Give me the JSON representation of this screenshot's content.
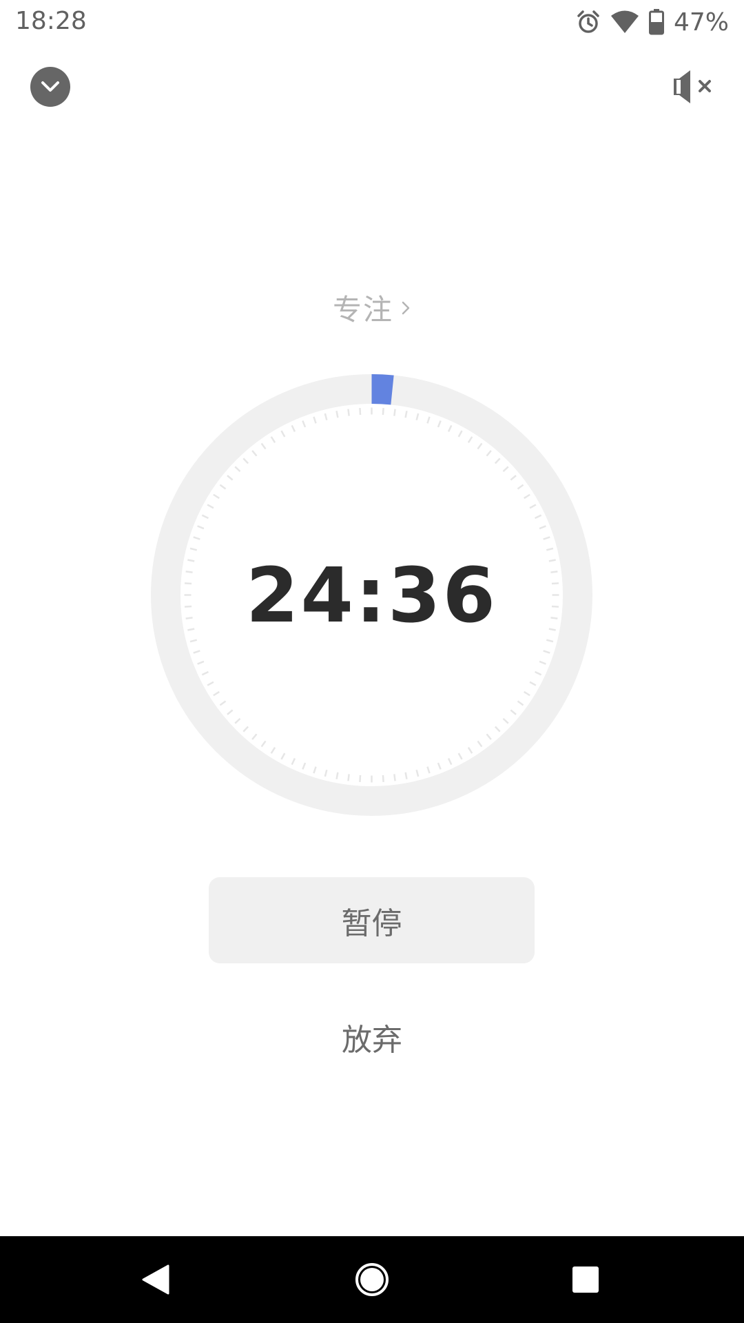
{
  "status_bar": {
    "time": "18:28",
    "battery_percent": "47%",
    "icons": [
      "alarm-icon",
      "wifi-icon",
      "battery-icon"
    ]
  },
  "header": {
    "collapse_icon": "chevron-down-icon",
    "mute_icon": "volume-muted-icon"
  },
  "mode": {
    "label": "专注",
    "chevron_icon": "chevron-right-icon"
  },
  "timer": {
    "display": "24:36",
    "progress_fraction": 0.016
  },
  "actions": {
    "pause_label": "暂停",
    "abandon_label": "放弃"
  },
  "nav": {
    "icons": [
      "back-icon",
      "home-icon",
      "recents-icon"
    ]
  },
  "colors": {
    "accent": "#6283e0",
    "ring": "#f0f0f0",
    "tick": "#e6e6e6",
    "timer_text": "#2b2b2b",
    "muted_text": "#b4b4b4"
  }
}
